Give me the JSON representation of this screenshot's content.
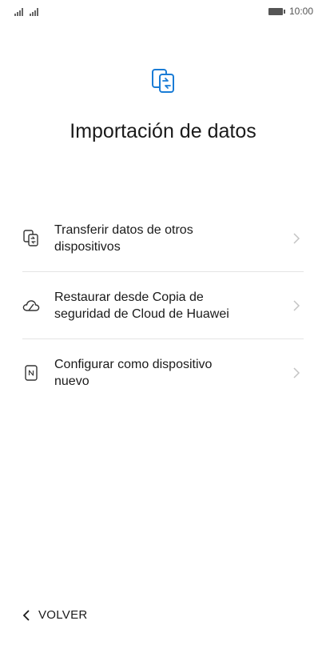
{
  "status_bar": {
    "time": "10:00",
    "accent": "#555555"
  },
  "header": {
    "icon": "phone-transfer-icon",
    "icon_color": "#1a7cd6",
    "title": "Importación de datos"
  },
  "options": [
    {
      "icon": "phone-transfer-icon",
      "line1": "Transferir datos de otros",
      "line2": "dispositivos"
    },
    {
      "icon": "cloud-icon",
      "line1": "Restaurar desde Copia de",
      "line2": "seguridad de Cloud de Huawei"
    },
    {
      "icon": "nfc-card-icon",
      "line1": "Configurar como dispositivo",
      "line2": "nuevo"
    }
  ],
  "footer": {
    "back_label": "VOLVER"
  }
}
